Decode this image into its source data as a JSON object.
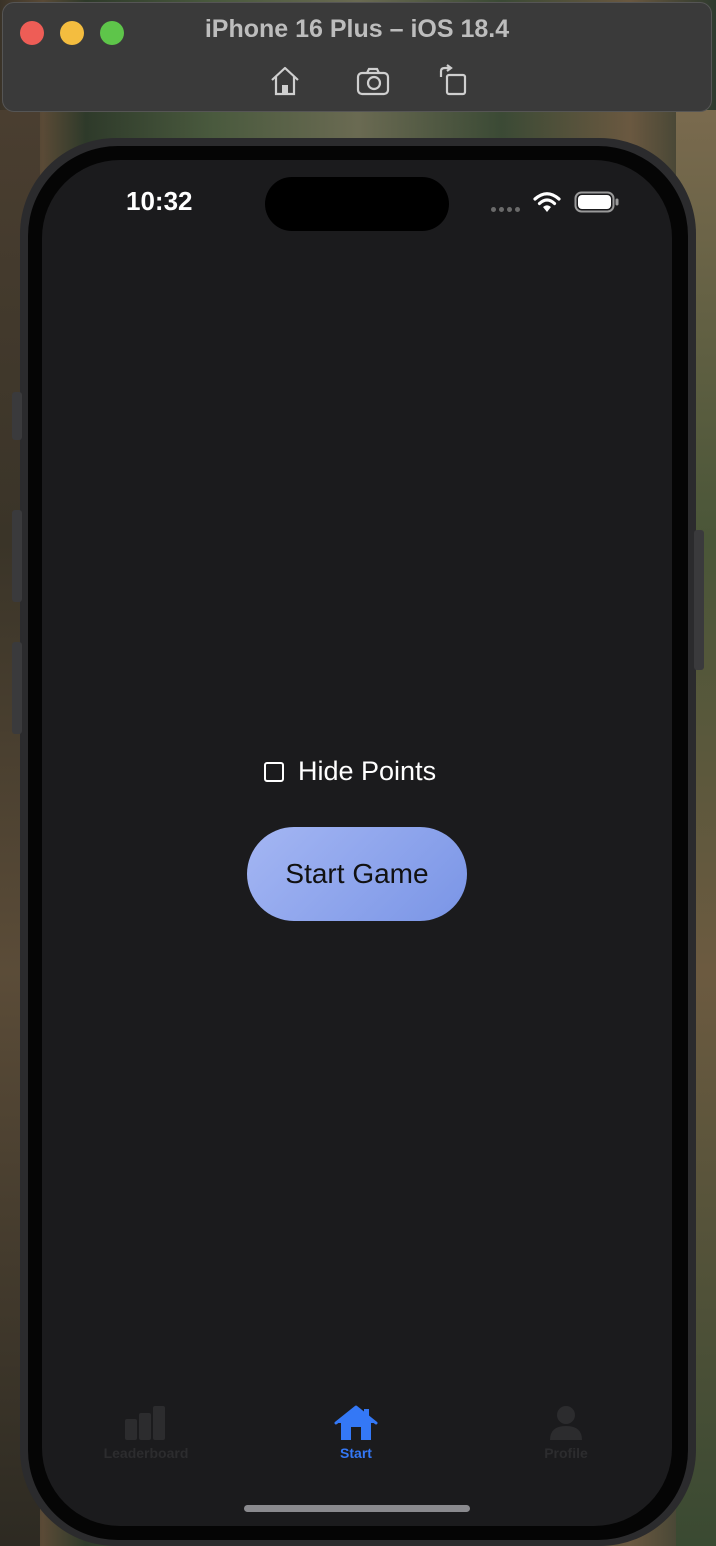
{
  "simulator": {
    "title": "iPhone 16 Plus – iOS 18.4",
    "tools": [
      "home-icon",
      "screenshot-icon",
      "rotate-icon"
    ]
  },
  "status_bar": {
    "time": "10:32",
    "icons": [
      "cellular-dots-icon",
      "wifi-icon",
      "battery-icon"
    ]
  },
  "main": {
    "hide_points_label": "Hide Points",
    "hide_points_checked": false,
    "start_button_label": "Start Game"
  },
  "tabbar": {
    "items": [
      {
        "label": "Leaderboard",
        "icon": "chart-bars-icon",
        "active": false
      },
      {
        "label": "Start",
        "icon": "house-icon",
        "active": true
      },
      {
        "label": "Profile",
        "icon": "person-icon",
        "active": false
      }
    ]
  },
  "colors": {
    "accent": "#3478f6",
    "button_gradient_start": "#a4b6f3",
    "button_gradient_end": "#7a95e6",
    "screen_background": "#1b1b1d"
  }
}
